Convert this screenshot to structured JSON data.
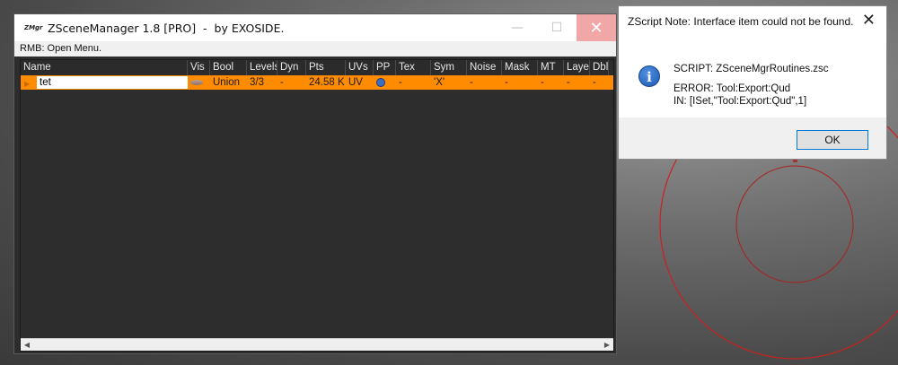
{
  "zscene_window": {
    "logo": "ZMgr",
    "title": "ZSceneManager 1.8 [PRO]  -  by EXOSIDE.",
    "controls": {
      "minimize": "—",
      "maximize": "☐",
      "close": "✕"
    },
    "menu_hint": "RMB: Open Menu.",
    "columns": [
      "Name",
      "Vis",
      "Bool",
      "Levels",
      "Dyn",
      "Pts",
      "UVs",
      "PP",
      "Tex",
      "Sym",
      "Noise",
      "Mask",
      "MT",
      "Layer",
      "Dbl"
    ],
    "rows": [
      {
        "name": "tet",
        "vis": "",
        "bool": "Union",
        "levels": "3/3",
        "dyn": "-",
        "pts": "24.58 K",
        "uvs": "UV",
        "pp": "",
        "tex": "-",
        "sym": "'X'",
        "noise": "-",
        "mask": "-",
        "mt": "-",
        "layer": "-",
        "dbl": "-"
      }
    ],
    "scroll_left": "◀",
    "scroll_right": "▶"
  },
  "dialog": {
    "title": "ZScript Note: Interface item could not be found.",
    "close": "✕",
    "icon": "info-icon",
    "icon_glyph": "i",
    "lines": [
      "SCRIPT: ZSceneMgrRoutines.zsc",
      "ERROR: Tool:Export:Qud",
      "IN: [ISet,\"Tool:Export:Qud\",1]"
    ],
    "ok_label": "OK"
  },
  "colors": {
    "selected_row": "#ff8c00",
    "grid_bg": "#2d2d2d",
    "viewport_circle": "#cc2020"
  }
}
